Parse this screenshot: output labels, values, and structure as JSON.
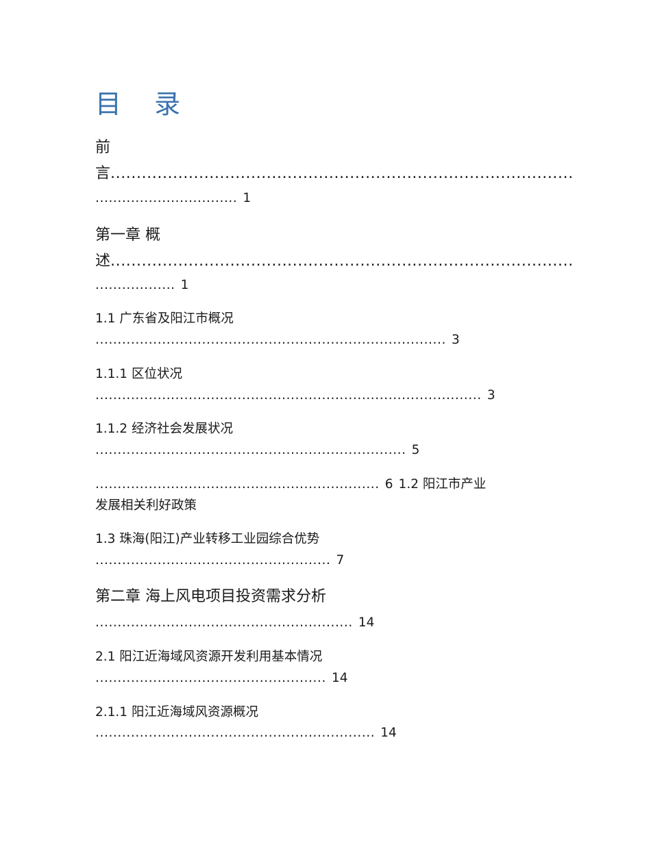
{
  "toc": {
    "title": "目 录",
    "entries": [
      {
        "label_l1": "前",
        "label_l2": "言",
        "dots_l2": ".........................................................................................",
        "dots_l3": "................................",
        "page": "1"
      },
      {
        "label_l1": "第一章 概",
        "label_l2": "述",
        "dots_l2": ".........................................................................................",
        "dots_l3": "..................",
        "page": "1"
      },
      {
        "label": "1.1 广东省及阳江市概况",
        "dots": "...............................................................................",
        "page": "3"
      },
      {
        "label": "1.1.1 区位状况",
        "dots": ".......................................................................................",
        "page": "3"
      },
      {
        "label": "1.1.2 经济社会发展状况",
        "dots": "......................................................................",
        "page": "5"
      },
      {
        "dots_pre": "................................................................",
        "page_pre": "6",
        "label_l1": "1.2 阳江市产业",
        "label_l2": "发展相关利好政策"
      },
      {
        "label": "1.3 珠海(阳江)产业转移工业园综合优势",
        "dots": ".....................................................",
        "page": "7"
      },
      {
        "label": "第二章 海上风电项目投资需求分析",
        "dots": "..........................................................",
        "page": "14"
      },
      {
        "label": "2.1 阳江近海域风资源开发利用基本情况",
        "dots": "....................................................",
        "page": "14"
      },
      {
        "label": "2.1.1 阳江近海域风资源概况",
        "dots": "...............................................................",
        "page": "14"
      }
    ]
  }
}
